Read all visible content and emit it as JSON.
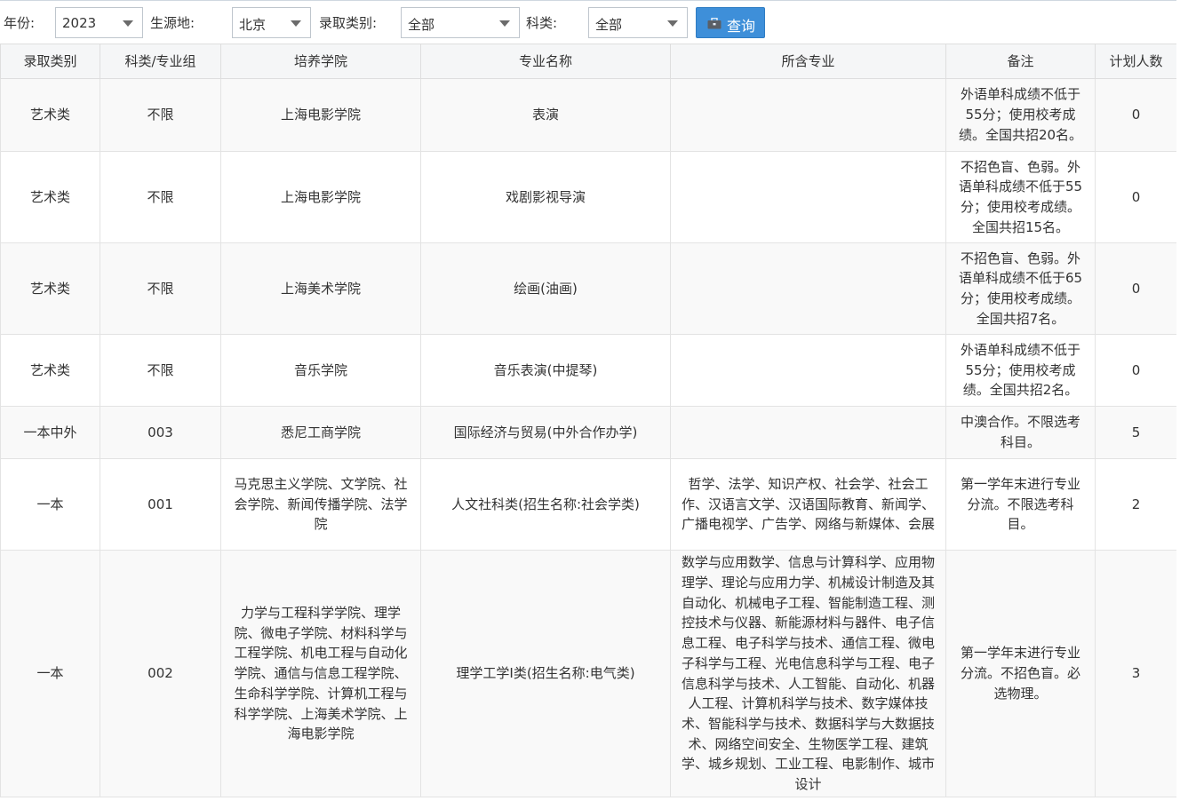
{
  "filters": {
    "year_label": "年份:",
    "year_value": "2023",
    "region_label": "生源地:",
    "region_value": "北京",
    "admission_type_label": "录取类别:",
    "admission_type_value": "全部",
    "subject_label": "科类:",
    "subject_value": "全部",
    "query_label": "查询"
  },
  "table": {
    "headers": [
      "录取类别",
      "科类/专业组",
      "培养学院",
      "专业名称",
      "所含专业",
      "备注",
      "计划人数"
    ],
    "rows": [
      [
        "艺术类",
        "不限",
        "上海电影学院",
        "表演",
        "",
        "外语单科成绩不低于55分；使用校考成绩。全国共招20名。",
        "0"
      ],
      [
        "艺术类",
        "不限",
        "上海电影学院",
        "戏剧影视导演",
        "",
        "不招色盲、色弱。外语单科成绩不低于55分；使用校考成绩。全国共招15名。",
        "0"
      ],
      [
        "艺术类",
        "不限",
        "上海美术学院",
        "绘画(油画)",
        "",
        "不招色盲、色弱。外语单科成绩不低于65分；使用校考成绩。全国共招7名。",
        "0"
      ],
      [
        "艺术类",
        "不限",
        "音乐学院",
        "音乐表演(中提琴)",
        "",
        "外语单科成绩不低于55分；使用校考成绩。全国共招2名。",
        "0"
      ],
      [
        "一本中外",
        "003",
        "悉尼工商学院",
        "国际经济与贸易(中外合作办学)",
        "",
        "中澳合作。不限选考科目。",
        "5"
      ],
      [
        "一本",
        "001",
        "马克思主义学院、文学院、社会学院、新闻传播学院、法学院",
        "人文社科类(招生名称:社会学类)",
        "哲学、法学、知识产权、社会学、社会工作、汉语言文学、汉语国际教育、新闻学、广播电视学、广告学、网络与新媒体、会展",
        "第一学年末进行专业分流。不限选考科目。",
        "2"
      ],
      [
        "一本",
        "002",
        "力学与工程科学学院、理学院、微电子学院、材料科学与工程学院、机电工程与自动化学院、通信与信息工程学院、生命科学学院、计算机工程与科学学院、上海美术学院、上海电影学院",
        "理学工学I类(招生名称:电气类)",
        "数学与应用数学、信息与计算科学、应用物理学、理论与应用力学、机械设计制造及其自动化、机械电子工程、智能制造工程、测控技术与仪器、新能源材料与器件、电子信息工程、电子科学与技术、通信工程、微电子科学与工程、光电信息科学与工程、电子信息科学与技术、人工智能、自动化、机器人工程、计算机科学与技术、数字媒体技术、智能科学与技术、数据科学与大数据技术、网络空间安全、生物医学工程、建筑学、城乡规划、工业工程、电影制作、城市设计",
        "第一学年末进行专业分流。不招色盲。必选物理。",
        "3"
      ]
    ]
  },
  "colors": {
    "query_button": "#3e8fd9",
    "header_bg": "#f5f6f7",
    "odd_row_bg": "#f9f9f9"
  },
  "icons": {
    "query_button_icon": "briefcase-icon",
    "select_arrow": "caret-down-icon"
  }
}
